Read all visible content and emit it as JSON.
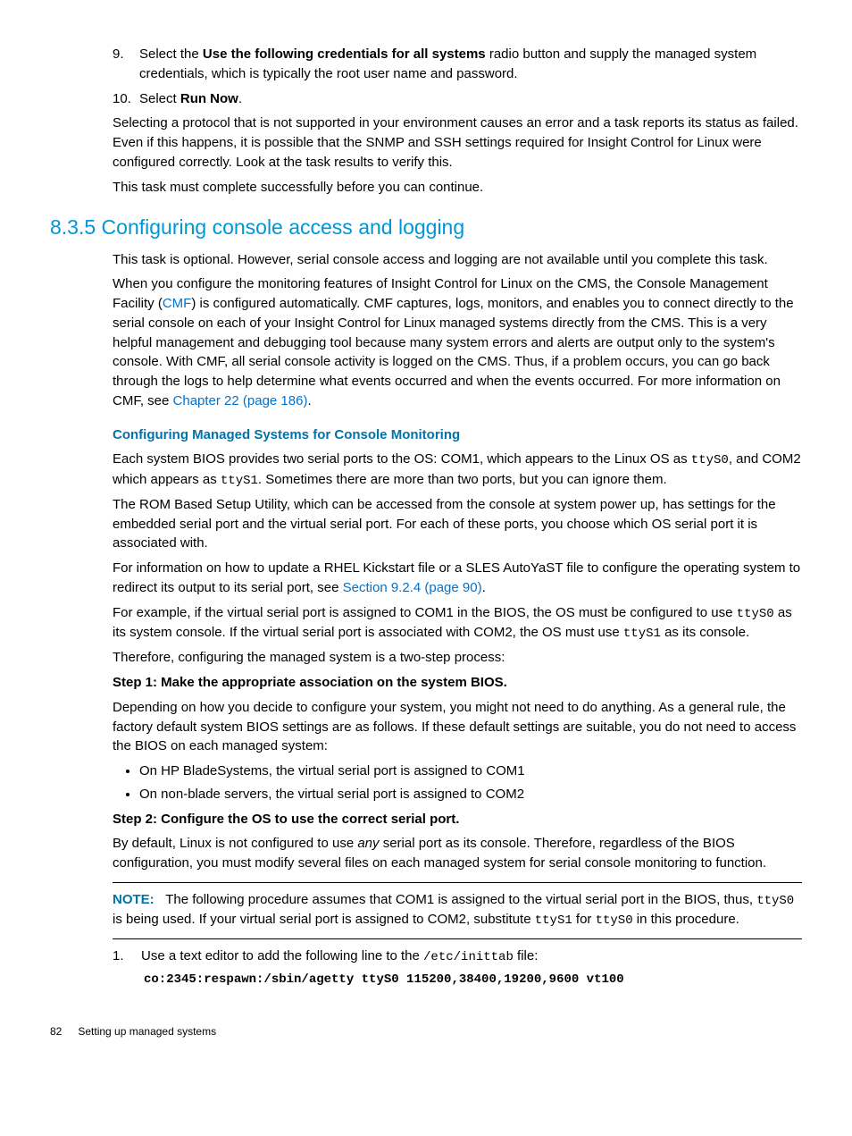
{
  "list9": {
    "num": "9.",
    "t1": "Select the ",
    "bold": "Use the following credentials for all systems",
    "t2": " radio button and supply the managed system credentials, which is typically the root user name and password."
  },
  "list10": {
    "num": "10.",
    "t1": "Select ",
    "bold": "Run Now",
    "t2": "."
  },
  "para_protocol": "Selecting a protocol that is not supported in your environment causes an error and a task reports its status as failed. Even if this happens, it is possible that the SNMP and SSH settings required for Insight Control for Linux were configured correctly. Look at the task results to verify this.",
  "para_complete": "This task must complete successfully before you can continue.",
  "h835": "8.3.5 Configuring console access and logging",
  "para_optional": "This task is optional. However, serial console access and logging are not available until you complete this task.",
  "cmf": {
    "t1": "When you configure the monitoring features of Insight Control for Linux on the CMS, the Console Management Facility (",
    "link1": "CMF",
    "t2": ") is configured automatically. CMF captures, logs, monitors, and enables you to connect directly to the serial console on each of your Insight Control for Linux managed systems directly from the CMS. This is a very helpful management and debugging tool because many system errors and alerts are output only to the system's console. With CMF, all serial console activity is logged on the CMS. Thus, if a problem occurs, you can go back through the logs to help determine what events occurred and when the events occurred. For more information on CMF, see ",
    "link2": "Chapter 22 (page 186)",
    "t3": "."
  },
  "sub_title": "Configuring Managed Systems for Console Monitoring",
  "bios": {
    "t1": "Each system BIOS provides two serial ports to the OS: COM1, which appears to the Linux OS as ",
    "m1": "ttyS0",
    "t2": ", and COM2 which appears as ",
    "m2": "ttyS1",
    "t3": ". Sometimes there are more than two ports, but you can ignore them."
  },
  "rom": "The ROM Based Setup Utility, which can be accessed from the console at system power up, has settings for the embedded serial port and the virtual serial port. For each of these ports, you choose which OS serial port it is associated with.",
  "rhel": {
    "t1": "For information on how to update a RHEL Kickstart file or a SLES AutoYaST file to configure the operating system to redirect its output to its serial port, see ",
    "link": "Section 9.2.4 (page 90)",
    "t2": "."
  },
  "example": {
    "t1": "For example, if the virtual serial port is assigned to COM1 in the BIOS, the OS must be configured to use ",
    "m1": "ttyS0",
    "t2": " as its system console. If the virtual serial port is associated with COM2, the OS must use ",
    "m2": "ttyS1",
    "t3": " as its console."
  },
  "therefore": "Therefore, configuring the managed system is a two-step process:",
  "step1_h": "Step 1: Make the appropriate association on the system BIOS.",
  "step1_p": "Depending on how you decide to configure your system, you might not need to do anything. As a general rule, the factory default system BIOS settings are as follows. If these default settings are suitable, you do not need to access the BIOS on each managed system:",
  "bul1": "On HP BladeSystems, the virtual serial port is assigned to COM1",
  "bul2": "On non-blade servers, the virtual serial port is assigned to COM2",
  "step2_h": "Step 2: Configure the OS to use the correct serial port.",
  "step2_p": {
    "t1": "By default, Linux is not configured to use ",
    "it": "any",
    "t2": " serial port as its console. Therefore, regardless of the BIOS configuration, you must modify several files on each managed system for serial console monitoring to function."
  },
  "note": {
    "label": "NOTE:",
    "t1": "The following procedure assumes that COM1 is assigned to the virtual serial port in the BIOS, thus, ",
    "m1": "ttyS0",
    "t2": " is being used. If your virtual serial port is assigned to COM2, substitute ",
    "m2": "ttyS1",
    "t3": " for ",
    "m3": "ttyS0",
    "t4": " in this procedure."
  },
  "proc1": {
    "num": "1.",
    "t1": "Use a text editor to add the following line to the ",
    "m1": "/etc/inittab",
    "t2": " file:",
    "code": "co:2345:respawn:/sbin/agetty ttyS0 115200,38400,19200,9600 vt100"
  },
  "footer": {
    "page": "82",
    "title": "Setting up managed systems"
  }
}
